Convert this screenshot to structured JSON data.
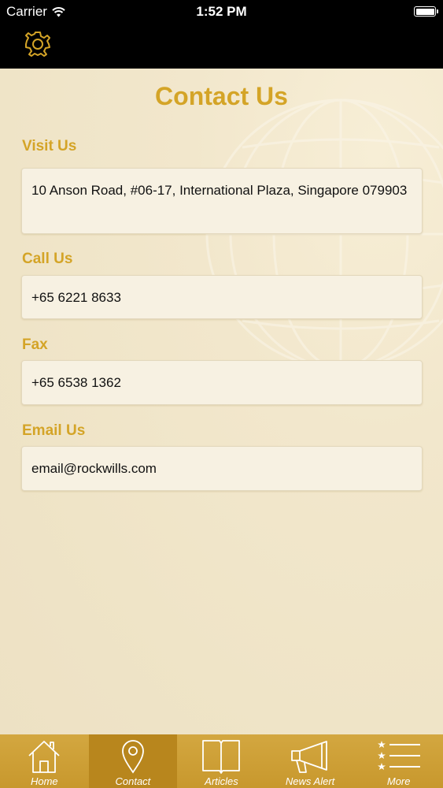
{
  "status": {
    "carrier": "Carrier",
    "time": "1:52 PM"
  },
  "navbar": {
    "settings_icon": "gear-icon"
  },
  "page": {
    "title": "Contact Us"
  },
  "sections": {
    "visit": {
      "label": "Visit Us",
      "value": "10 Anson Road, #06-17, International Plaza, Singapore 079903"
    },
    "call": {
      "label": "Call Us",
      "value": "+65 6221 8633"
    },
    "fax": {
      "label": "Fax",
      "value": "+65 6538 1362"
    },
    "email": {
      "label": "Email Us",
      "value": "email@rockwills.com"
    }
  },
  "tabs": [
    {
      "label": "Home",
      "icon": "home-icon"
    },
    {
      "label": "Contact",
      "icon": "location-pin-icon",
      "active": true
    },
    {
      "label": "Articles",
      "icon": "book-icon"
    },
    {
      "label": "News Alert",
      "icon": "megaphone-icon"
    },
    {
      "label": "More",
      "icon": "more-list-icon"
    }
  ],
  "colors": {
    "accent": "#d4a427",
    "tabbar": "#c8982d",
    "tab_active": "#b8861d",
    "background": "#efe4c7"
  }
}
